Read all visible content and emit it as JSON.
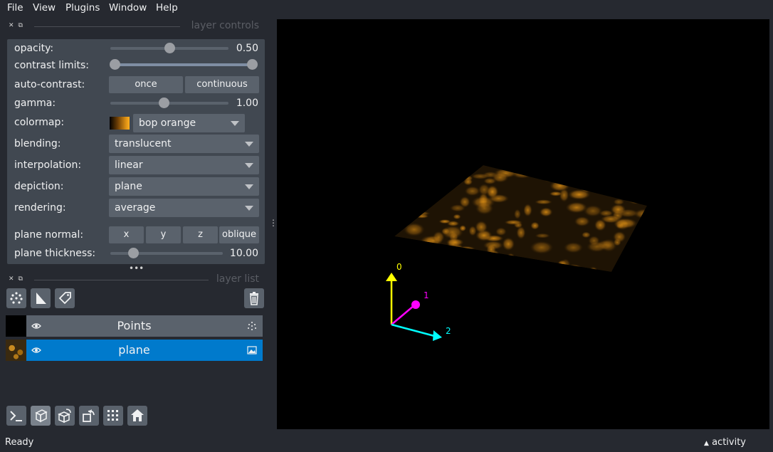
{
  "menu": {
    "file": "File",
    "view": "View",
    "plugins": "Plugins",
    "window": "Window",
    "help": "Help"
  },
  "layer_controls": {
    "title": "layer controls",
    "opacity": {
      "label": "opacity:",
      "value": "0.50",
      "fraction": 0.5
    },
    "contrast_limits": {
      "label": "contrast limits:",
      "low": 0.0,
      "high": 1.0
    },
    "auto_contrast": {
      "label": "auto-contrast:",
      "once": "once",
      "continuous": "continuous"
    },
    "gamma": {
      "label": "gamma:",
      "value": "1.00",
      "fraction": 0.45
    },
    "colormap": {
      "label": "colormap:",
      "value": "bop orange"
    },
    "blending": {
      "label": "blending:",
      "value": "translucent"
    },
    "interpolation": {
      "label": "interpolation:",
      "value": "linear"
    },
    "depiction": {
      "label": "depiction:",
      "value": "plane"
    },
    "rendering": {
      "label": "rendering:",
      "value": "average"
    },
    "plane_normal": {
      "label": "plane normal:",
      "x": "x",
      "y": "y",
      "z": "z",
      "oblique": "oblique"
    },
    "plane_thickness": {
      "label": "plane thickness:",
      "value": "10.00",
      "fraction": 0.2
    }
  },
  "layer_list": {
    "title": "layer list",
    "layers": [
      {
        "name": "Points",
        "selected": false,
        "type": "points"
      },
      {
        "name": "plane",
        "selected": true,
        "type": "image"
      }
    ]
  },
  "axes": {
    "x0": "0",
    "x1": "1",
    "x2": "2"
  },
  "colors": {
    "accent": "#007acc",
    "axis0": "#ffff00",
    "axis1": "#ff00ff",
    "axis2": "#00ffff",
    "bop_orange": "#d98d14"
  },
  "status": {
    "text": "Ready",
    "activity": "activity"
  }
}
